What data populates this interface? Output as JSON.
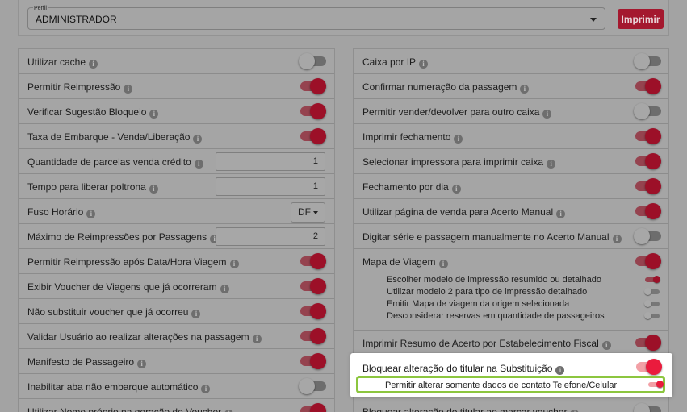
{
  "header": {
    "profile_legend": "Perfil",
    "profile_value": "ADMINISTRADOR",
    "print_label": "Imprimir"
  },
  "left": [
    {
      "label": "Utilizar cache",
      "control": "toggle",
      "value": false
    },
    {
      "label": "Permitir Reimpressão",
      "control": "toggle",
      "value": true
    },
    {
      "label": "Verificar Sugestão Bloqueio",
      "control": "toggle",
      "value": true
    },
    {
      "label": "Taxa de Embarque - Venda/Liberação",
      "control": "toggle",
      "value": true
    },
    {
      "label": "Quantidade de parcelas venda crédito",
      "control": "number",
      "value": "1"
    },
    {
      "label": "Tempo para liberar poltrona",
      "control": "number",
      "value": "1"
    },
    {
      "label": "Fuso Horário",
      "control": "select",
      "value": "DF"
    },
    {
      "label": "Máximo de Reimpressões por Passagens",
      "control": "number",
      "value": "2"
    },
    {
      "label": "Permitir Reimpressão após Data/Hora Viagem",
      "control": "toggle",
      "value": true
    },
    {
      "label": "Exibir Voucher de Viagens que já ocorreram",
      "control": "toggle",
      "value": true
    },
    {
      "label": "Não substituir voucher que já ocorreu",
      "control": "toggle",
      "value": true
    },
    {
      "label": "Validar Usuário ao realizar alterações na passagem",
      "control": "toggle",
      "value": true
    },
    {
      "label": "Manifesto de Passageiro",
      "control": "toggle",
      "value": true
    },
    {
      "label": "Inabilitar aba não embarque automático",
      "control": "toggle",
      "value": false
    },
    {
      "label": "Utilizar Nome próprio na geração de Voucher",
      "control": "toggle",
      "value": true
    }
  ],
  "right": [
    {
      "label": "Caixa por IP",
      "control": "toggle",
      "value": false
    },
    {
      "label": "Confirmar numeração da passagem",
      "control": "toggle",
      "value": true
    },
    {
      "label": "Permitir vender/devolver para outro caixa",
      "control": "toggle",
      "value": false
    },
    {
      "label": "Imprimir fechamento",
      "control": "toggle",
      "value": true
    },
    {
      "label": "Selecionar impressora para imprimir caixa",
      "control": "toggle",
      "value": true
    },
    {
      "label": "Fechamento por dia",
      "control": "toggle",
      "value": true
    },
    {
      "label": "Utilizar página de venda para Acerto Manual",
      "control": "toggle",
      "value": true
    },
    {
      "label": "Digitar série e passagem manualmente no Acerto Manual",
      "control": "toggle",
      "value": false
    }
  ],
  "mapa": {
    "label": "Mapa de Viagem",
    "value": true,
    "subitems": [
      {
        "label": "Escolher modelo de impressão resumido ou detalhado",
        "value": true
      },
      {
        "label": "Utilizar modelo 2 para tipo de impressão detalhado",
        "value": false
      },
      {
        "label": "Emitir Mapa de viagem da origem selecionada",
        "value": false
      },
      {
        "label": "Desconsiderar reservas em quantidade de passageiros",
        "value": false
      }
    ]
  },
  "right_after": [
    {
      "label": "Imprimir Resumo de Acerto por Estabelecimento Fiscal",
      "value": true
    }
  ],
  "highlight": {
    "label": "Bloquear alteração do titular na Substituição",
    "value": true,
    "sub_label": "Permitir alterar somente dados de contato Telefone/Celular",
    "sub_value": true
  },
  "right_bottom": {
    "label": "Bloquear alteração do titular ao marcar voucher",
    "value": false
  },
  "colors": {
    "accent": "#e8173a",
    "accent_dimmed": "#9c1028",
    "highlight_border": "#8cc63f",
    "overlay_bg": "#a3a3a3"
  }
}
